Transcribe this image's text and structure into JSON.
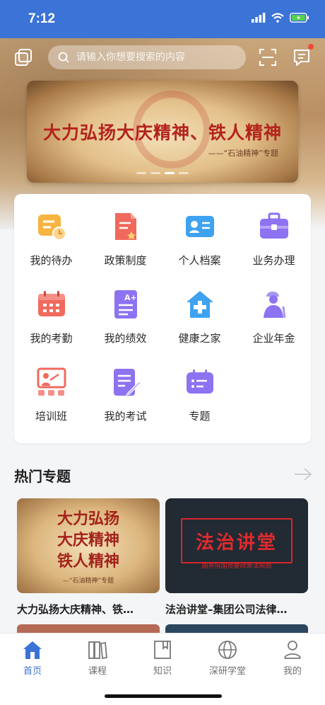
{
  "status_bar": {
    "time": "7:12"
  },
  "search": {
    "placeholder": "请输入你想要搜索的内容"
  },
  "banner": {
    "title": "大力弘扬大庆精神、铁人精神",
    "subtitle": "——“石油精神”专题",
    "slides": 4,
    "active_slide": 2
  },
  "grid": [
    {
      "label": "我的待办",
      "icon": "todo-icon"
    },
    {
      "label": "政策制度",
      "icon": "policy-icon"
    },
    {
      "label": "个人档案",
      "icon": "profile-card-icon"
    },
    {
      "label": "业务办理",
      "icon": "briefcase-icon"
    },
    {
      "label": "我的考勤",
      "icon": "calendar-icon"
    },
    {
      "label": "我的绩效",
      "icon": "performance-icon"
    },
    {
      "label": "健康之家",
      "icon": "health-house-icon"
    },
    {
      "label": "企业年金",
      "icon": "pension-icon"
    },
    {
      "label": "培训班",
      "icon": "training-icon"
    },
    {
      "label": "我的考试",
      "icon": "exam-icon"
    },
    {
      "label": "专题",
      "icon": "topic-icon"
    }
  ],
  "hot_topics": {
    "title": "热门专题",
    "cards": [
      {
        "image_title": "大力弘扬\n大庆精神\n铁人精神",
        "image_sub": "—“石油精神”专题",
        "caption": "大力弘扬大庆精神、铁…"
      },
      {
        "image_title": "法治讲堂",
        "image_sub": "国务院国资委政策法规局",
        "caption": "法治讲堂–集团公司法律…"
      }
    ]
  },
  "tabbar": [
    {
      "label": "首页",
      "icon": "home-icon",
      "active": true
    },
    {
      "label": "课程",
      "icon": "books-icon",
      "active": false
    },
    {
      "label": "知识",
      "icon": "book-icon",
      "active": false
    },
    {
      "label": "深研学堂",
      "icon": "globe-icon",
      "active": false
    },
    {
      "label": "我的",
      "icon": "person-icon",
      "active": false
    }
  ],
  "colors": {
    "primary": "#3b73d6",
    "notification_dot": "#f04a3c"
  }
}
